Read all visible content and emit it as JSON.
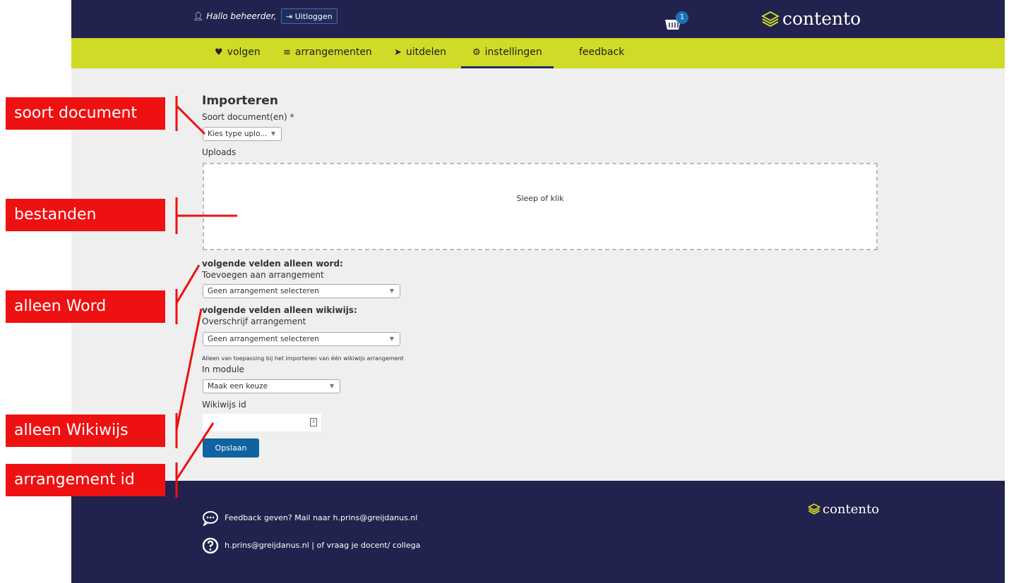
{
  "header": {
    "greeting": "Hallo beheerder,",
    "logout_label": "Uitloggen",
    "cart_count": "1",
    "logo_text": "contento"
  },
  "nav": {
    "items": [
      {
        "icon": "heartbeat-icon",
        "label": "volgen"
      },
      {
        "icon": "layers-icon",
        "label": "arrangementen"
      },
      {
        "icon": "paper-plane-icon",
        "label": "uitdelen"
      },
      {
        "icon": "gear-icon",
        "label": "instellingen"
      },
      {
        "icon": "",
        "label": "feedback"
      }
    ],
    "active": "instellingen"
  },
  "form": {
    "title": "Importeren",
    "doc_type_label": "Soort document(en) *",
    "doc_type_value": "Kies type uplo...",
    "uploads_label": "Uploads",
    "dropzone_text": "Sleep of klik",
    "word_heading": "volgende velden alleen word:",
    "add_to_label": "Toevoegen aan arrangement",
    "add_to_value": "Geen arrangement selecteren",
    "wikiwijs_heading": "volgende velden alleen wikiwijs:",
    "overwrite_label": "Overschrijf arrangement",
    "overwrite_value": "Geen arrangement selecteren",
    "wikiwijs_note": "Alleen van toepassing bij het importeren van één wikiwijs arrangement",
    "module_label": "In module",
    "module_value": "Maak een keuze",
    "wikiwijs_id_label": "Wikiwijs id",
    "wikiwijs_id_value": "",
    "save_label": "Opslaan"
  },
  "footer": {
    "feedback_text": "Feedback geven? Mail naar h.prins@greijdanus.nl",
    "help_text": "h.prins@greijdanus.nl | of vraag je docent/ collega",
    "logo_text": "contento"
  },
  "callouts": {
    "soort_document": "soort document",
    "bestanden": "bestanden",
    "alleen_word": "alleen Word",
    "alleen_wikiwijs": "alleen Wikiwijs",
    "arrangement_id": "arrangement id"
  },
  "colors": {
    "header_bg": "#22224e",
    "nav_bg": "#cfdb27",
    "button_bg": "#0f64a0",
    "callout_bg": "#ee1111"
  }
}
